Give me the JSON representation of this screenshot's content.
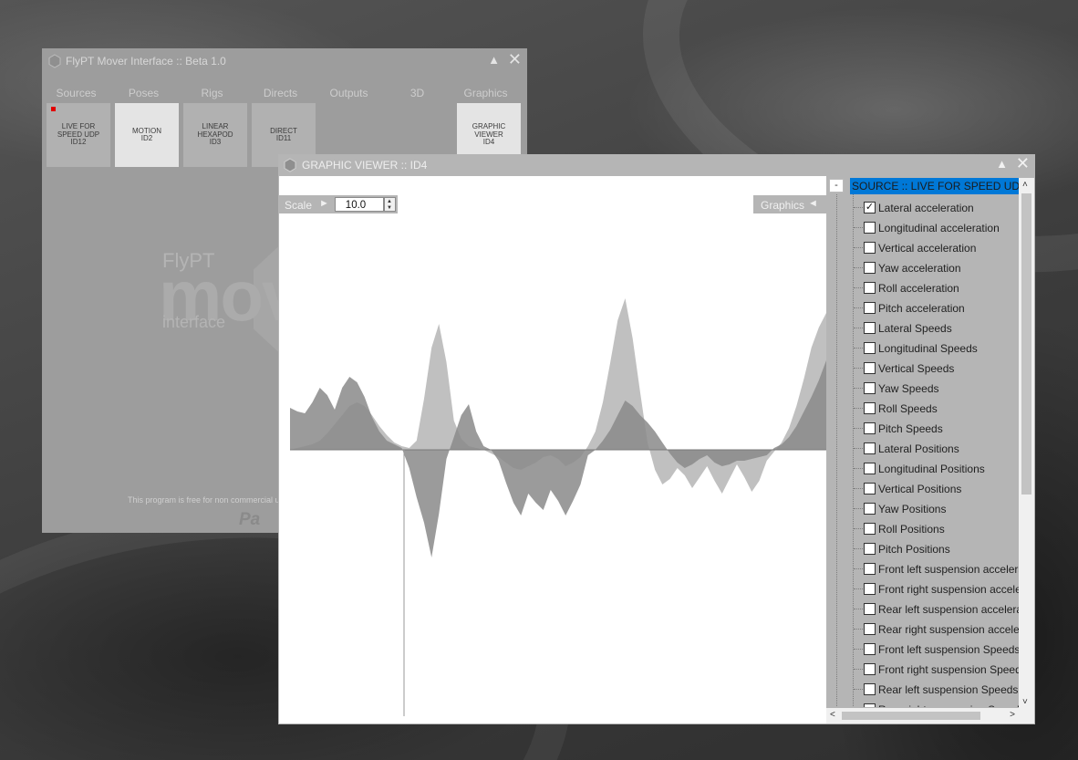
{
  "main_window": {
    "title": "FlyPT Mover Interface :: Beta 1.0",
    "tabs": [
      "Sources",
      "Poses",
      "Rigs",
      "Directs",
      "Outputs",
      "3D",
      "Graphics"
    ],
    "cards": [
      {
        "lines": [
          "LIVE FOR",
          "SPEED UDP",
          "ID12"
        ]
      },
      {
        "lines": [
          "MOTION",
          "ID2"
        ]
      },
      {
        "lines": [
          "LINEAR",
          "HEXAPOD",
          "ID3"
        ]
      },
      {
        "lines": [
          "DIRECT",
          "ID11"
        ]
      },
      {
        "lines": [
          "GRAPHIC",
          "VIEWER",
          "ID4"
        ]
      }
    ],
    "brand": {
      "line1": "FlyPT",
      "line2": "mov",
      "line3": "interface"
    },
    "notice": "This program is free for non commercial u",
    "paypal": "Pa",
    "maximize_glyph": "▲",
    "close_glyph": "✕",
    "accent_color": "#e20000"
  },
  "viewer": {
    "title": "GRAPHIC VIEWER :: ID4",
    "scale_label": "Scale",
    "scale_arrow": "►",
    "scale_value": "10.0",
    "graphics_label": "Graphics",
    "graphics_arrow": "◄",
    "collapse": "-",
    "source_label": "SOURCE :: LIVE FOR SPEED UDP ::",
    "selection_color": "#0078d7",
    "channels": [
      {
        "label": "Lateral acceleration",
        "checked": true
      },
      {
        "label": "Longitudinal acceleration",
        "checked": false
      },
      {
        "label": "Vertical acceleration",
        "checked": false
      },
      {
        "label": "Yaw acceleration",
        "checked": false
      },
      {
        "label": "Roll acceleration",
        "checked": false
      },
      {
        "label": "Pitch acceleration",
        "checked": false
      },
      {
        "label": "Lateral Speeds",
        "checked": false
      },
      {
        "label": "Longitudinal Speeds",
        "checked": false
      },
      {
        "label": "Vertical Speeds",
        "checked": false
      },
      {
        "label": "Yaw Speeds",
        "checked": false
      },
      {
        "label": "Roll Speeds",
        "checked": false
      },
      {
        "label": "Pitch Speeds",
        "checked": false
      },
      {
        "label": "Lateral Positions",
        "checked": false
      },
      {
        "label": "Longitudinal Positions",
        "checked": false
      },
      {
        "label": "Vertical Positions",
        "checked": false
      },
      {
        "label": "Yaw Positions",
        "checked": false
      },
      {
        "label": "Roll Positions",
        "checked": false
      },
      {
        "label": "Pitch Positions",
        "checked": false
      },
      {
        "label": "Front left suspension acceleration",
        "checked": false
      },
      {
        "label": "Front right suspension acceleration",
        "checked": false
      },
      {
        "label": "Rear left suspension acceleration",
        "checked": false
      },
      {
        "label": "Rear right suspension acceleration",
        "checked": false
      },
      {
        "label": "Front left suspension Speeds",
        "checked": false
      },
      {
        "label": "Front right suspension Speeds",
        "checked": false
      },
      {
        "label": "Rear left suspension Speeds",
        "checked": false
      },
      {
        "label": "Rear right suspension Speeds",
        "checked": false
      }
    ],
    "icons": {
      "maximize": "triangle-up-icon",
      "close": "close-icon",
      "scroll_up": "chevron-up-icon",
      "scroll_down": "chevron-down-icon",
      "scroll_left": "chevron-left-icon",
      "scroll_right": "chevron-right-icon"
    }
  },
  "chart_data": {
    "type": "area",
    "series": [
      {
        "color": "#b9b9b9",
        "values": [
          0,
          0.1,
          0.2,
          0.3,
          0.5,
          0.9,
          1.4,
          1.9,
          2.4,
          2.6,
          2.4,
          1.9,
          1.3,
          0.8,
          0.4,
          0.2,
          0.1,
          0.5,
          2.8,
          5.6,
          6.9,
          4.8,
          1.6,
          0.6,
          0.2,
          0.1,
          0,
          -0.2,
          -0.4,
          -0.7,
          -1.0,
          -1.1,
          -0.9,
          -0.7,
          -0.4,
          -0.3,
          -0.5,
          -0.9,
          -0.7,
          -0.4,
          0.2,
          1.0,
          2.6,
          4.8,
          7.1,
          8.3,
          6.1,
          3.2,
          0.4,
          -1.1,
          -1.9,
          -1.6,
          -1.0,
          -1.4,
          -2.1,
          -1.5,
          -0.9,
          -1.7,
          -2.4,
          -1.6,
          -0.8,
          -1.5,
          -2.3,
          -1.7,
          -0.6,
          -0.1,
          0.4,
          1.2,
          2.4,
          3.9,
          5.6,
          6.7,
          7.5
        ]
      },
      {
        "color": "#8a8a8a",
        "values": [
          2.3,
          2.1,
          2.0,
          2.6,
          3.4,
          3.0,
          2.2,
          3.4,
          4.0,
          3.7,
          2.9,
          1.8,
          1.0,
          0.5,
          0.3,
          0.1,
          -1.0,
          -2.6,
          -4.0,
          -5.9,
          -3.5,
          -0.5,
          0.7,
          1.9,
          2.5,
          1.0,
          0.2,
          0,
          -0.6,
          -1.8,
          -2.9,
          -3.6,
          -2.4,
          -2.9,
          -3.3,
          -2.2,
          -2.8,
          -3.6,
          -2.8,
          -1.9,
          -0.3,
          0,
          0.5,
          1.1,
          1.9,
          2.7,
          2.4,
          1.9,
          1.5,
          1.0,
          0.4,
          -0.2,
          -0.7,
          -1.0,
          -0.8,
          -0.5,
          -0.3,
          -0.7,
          -0.9,
          -0.8,
          -0.6,
          -0.6,
          -0.5,
          -0.4,
          -0.3,
          0.1,
          0.3,
          0.7,
          1.3,
          2.1,
          2.9,
          3.8,
          4.9
        ]
      }
    ],
    "ylim": [
      -12,
      12
    ],
    "grid": false
  }
}
